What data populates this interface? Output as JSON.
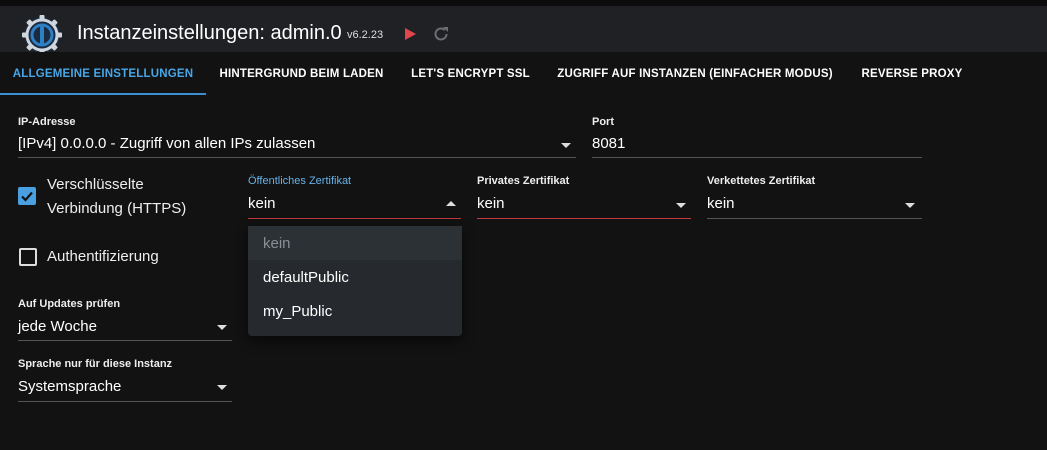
{
  "header": {
    "title": "Instanzeinstellungen: admin.0",
    "version": "v6.2.23",
    "colors": {
      "play": "#e0474c",
      "background": "#202124"
    }
  },
  "tabs": [
    {
      "label": "ALLGEMEINE EINSTELLUNGEN",
      "active": true
    },
    {
      "label": "HINTERGRUND BEIM LADEN"
    },
    {
      "label": "LET'S ENCRYPT SSL"
    },
    {
      "label": "ZUGRIFF AUF INSTANZEN (EINFACHER MODUS)"
    },
    {
      "label": "REVERSE PROXY"
    }
  ],
  "form": {
    "ip": {
      "label": "IP-Adresse",
      "value": "[IPv4] 0.0.0.0 - Zugriff von allen IPs zulassen"
    },
    "port": {
      "label": "Port",
      "value": "8081"
    },
    "https": {
      "label_line1": "Verschlüsselte",
      "label_line2": "Verbindung (HTTPS)",
      "checked": true
    },
    "auth": {
      "label": "Authentifizierung",
      "checked": false
    },
    "public_cert": {
      "label": "Öffentliches Zertifikat",
      "value": "kein",
      "open": true
    },
    "private_cert": {
      "label": "Privates Zertifikat",
      "value": "kein"
    },
    "chained_cert": {
      "label": "Verkettetes Zertifikat",
      "value": "kein"
    },
    "updates": {
      "label": "Auf Updates prüfen",
      "value": "jede Woche"
    },
    "language": {
      "label": "Sprache nur für diese Instanz",
      "value": "Systemsprache"
    }
  },
  "dropdown_menu": {
    "items": [
      "kein",
      "defaultPublic",
      "my_Public"
    ],
    "selected": "kein"
  }
}
